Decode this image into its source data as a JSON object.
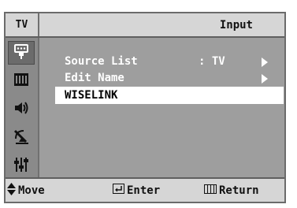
{
  "header": {
    "section": "TV",
    "title": "Input"
  },
  "sidebar": {
    "items": [
      {
        "icon": "input-icon",
        "active": true
      },
      {
        "icon": "picture-icon",
        "active": false
      },
      {
        "icon": "sound-icon",
        "active": false
      },
      {
        "icon": "channel-icon",
        "active": false
      },
      {
        "icon": "setup-icon",
        "active": false
      }
    ]
  },
  "menu": {
    "items": [
      {
        "label": "Source List",
        "value": ": TV",
        "has_arrow": true,
        "selected": false
      },
      {
        "label": "Edit Name",
        "value": "",
        "has_arrow": true,
        "selected": false
      },
      {
        "label": "WISELINK",
        "value": "",
        "has_arrow": false,
        "selected": true
      }
    ]
  },
  "footer": {
    "move_label": "Move",
    "enter_label": "Enter",
    "return_label": "Return"
  },
  "colors": {
    "header_bg": "#d6d6d6",
    "content_bg": "#9e9e9e",
    "sidebar_bg": "#8a8a8a",
    "text_light": "#ffffff",
    "selected_bg": "#ffffff"
  }
}
